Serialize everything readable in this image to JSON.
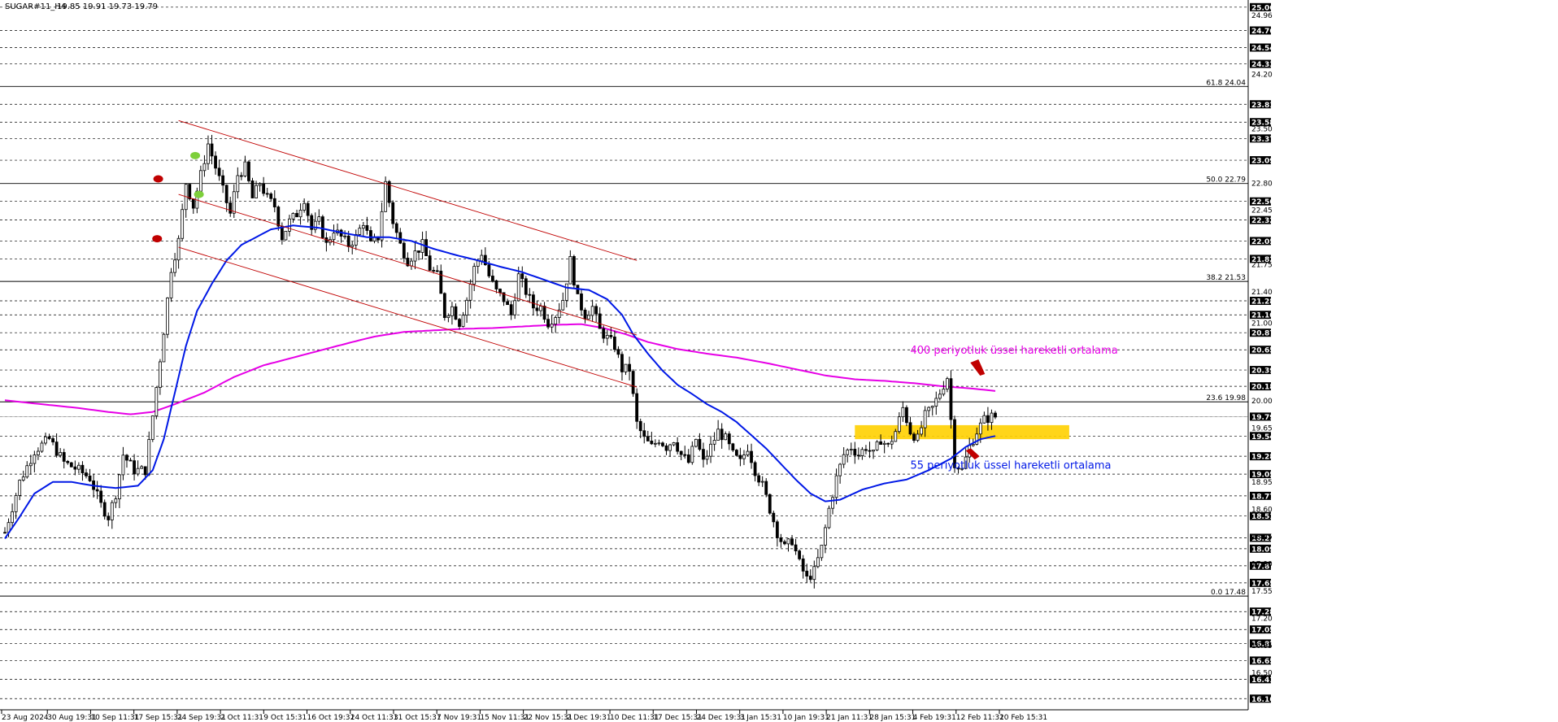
{
  "header": {
    "symbol": "SUGAR#11_H4",
    "ohlc": "19.85 19.91 19.73 19.79"
  },
  "colors": {
    "background": "#ffffff",
    "candle": "#000000",
    "ema55": "#0018e6",
    "ema400": "#e600e6",
    "channel": "#c00000",
    "zone": "#ffd000",
    "price_tag": "#000000",
    "marker_red": "#c00000",
    "marker_green": "#7dcf3a"
  },
  "chart_data": {
    "type": "line",
    "title": "",
    "ylim": [
      16.1,
      25.1
    ],
    "y_ticks_highlighted": [
      "25.06",
      "24.76",
      "24.54",
      "24.33",
      "23.81",
      "23.58",
      "23.37",
      "23.09",
      "22.56",
      "22.32",
      "22.05",
      "21.82",
      "21.28",
      "21.10",
      "20.87",
      "20.65",
      "20.39",
      "20.18",
      "19.79",
      "19.54",
      "19.28",
      "19.05",
      "18.77",
      "18.51",
      "18.23",
      "18.09",
      "17.87",
      "17.65",
      "17.28",
      "17.05",
      "16.87",
      "16.65",
      "16.41",
      "16.16"
    ],
    "y_ticks_plain": [
      "24.96",
      "24.20",
      "23.50",
      "22.80",
      "22.45",
      "21.75",
      "21.40",
      "21.00",
      "20.00",
      "19.65",
      "18.95",
      "18.60",
      "18.25",
      "17.90",
      "17.55",
      "17.20",
      "16.85",
      "16.50"
    ],
    "x_ticks": [
      "23 Aug 2024",
      "30 Aug 19:31",
      "10 Sep 11:31",
      "17 Sep 15:31",
      "24 Sep 19:31",
      "2 Oct 11:31",
      "9 Oct 15:31",
      "16 Oct 19:31",
      "24 Oct 11:31",
      "31 Oct 15:31",
      "7 Nov 19:31",
      "15 Nov 11:31",
      "22 Nov 15:31",
      "2 Dec 19:31",
      "10 Dec 11:31",
      "17 Dec 15:31",
      "24 Dec 19:31",
      "3 Jan 15:31",
      "10 Jan 19:31",
      "21 Jan 11:31",
      "28 Jan 15:31",
      "4 Feb 19:31",
      "12 Feb 11:31",
      "20 Feb 15:31"
    ],
    "fib_levels": [
      {
        "label": "61.8 24.04",
        "value": 24.04
      },
      {
        "label": "50.0 22.79",
        "value": 22.79
      },
      {
        "label": "38.2 21.53",
        "value": 21.53
      },
      {
        "label": "23.6 19.98",
        "value": 19.98
      },
      {
        "label": "0.0 17.48",
        "value": 17.48
      }
    ],
    "current_price_line": 19.79,
    "close_anchors": [
      [
        0,
        18.3
      ],
      [
        4,
        18.95
      ],
      [
        8,
        19.35
      ],
      [
        12,
        19.5
      ],
      [
        16,
        19.2
      ],
      [
        20,
        19.1
      ],
      [
        23,
        19.0
      ],
      [
        26,
        18.65
      ],
      [
        28,
        18.5
      ],
      [
        30,
        18.8
      ],
      [
        32,
        19.3
      ],
      [
        35,
        19.1
      ],
      [
        38,
        19.1
      ],
      [
        40,
        19.8
      ],
      [
        43,
        20.9
      ],
      [
        45,
        21.7
      ],
      [
        47,
        22.05
      ],
      [
        49,
        22.8
      ],
      [
        51,
        22.5
      ],
      [
        53,
        22.9
      ],
      [
        55,
        23.3
      ],
      [
        57,
        23.0
      ],
      [
        59,
        22.7
      ],
      [
        61,
        22.4
      ],
      [
        63,
        22.9
      ],
      [
        65,
        23.0
      ],
      [
        67,
        22.6
      ],
      [
        69,
        22.8
      ],
      [
        71,
        22.6
      ],
      [
        73,
        22.5
      ],
      [
        75,
        22.1
      ],
      [
        77,
        22.3
      ],
      [
        79,
        22.4
      ],
      [
        81,
        22.6
      ],
      [
        83,
        22.2
      ],
      [
        85,
        22.3
      ],
      [
        87,
        22.0
      ],
      [
        89,
        22.2
      ],
      [
        91,
        22.1
      ],
      [
        93,
        22.0
      ],
      [
        95,
        22.1
      ],
      [
        97,
        22.3
      ],
      [
        99,
        22.0
      ],
      [
        101,
        22.1
      ],
      [
        103,
        22.8
      ],
      [
        105,
        22.3
      ],
      [
        107,
        22.0
      ],
      [
        109,
        21.8
      ],
      [
        111,
        21.9
      ],
      [
        113,
        22.0
      ],
      [
        115,
        21.7
      ],
      [
        117,
        21.6
      ],
      [
        119,
        21.1
      ],
      [
        121,
        21.2
      ],
      [
        123,
        21.0
      ],
      [
        125,
        21.3
      ],
      [
        127,
        21.7
      ],
      [
        129,
        21.9
      ],
      [
        131,
        21.6
      ],
      [
        133,
        21.4
      ],
      [
        135,
        21.3
      ],
      [
        137,
        21.1
      ],
      [
        139,
        21.6
      ],
      [
        141,
        21.4
      ],
      [
        143,
        21.2
      ],
      [
        145,
        21.2
      ],
      [
        147,
        21.0
      ],
      [
        149,
        21.1
      ],
      [
        151,
        21.3
      ],
      [
        153,
        21.8
      ],
      [
        155,
        21.3
      ],
      [
        157,
        21.1
      ],
      [
        159,
        21.2
      ],
      [
        161,
        20.9
      ],
      [
        163,
        20.8
      ],
      [
        165,
        20.7
      ],
      [
        167,
        20.4
      ],
      [
        169,
        20.4
      ],
      [
        171,
        19.7
      ],
      [
        173,
        19.5
      ],
      [
        175,
        19.4
      ],
      [
        177,
        19.5
      ],
      [
        179,
        19.4
      ],
      [
        181,
        19.5
      ],
      [
        183,
        19.3
      ],
      [
        185,
        19.2
      ],
      [
        187,
        19.5
      ],
      [
        189,
        19.2
      ],
      [
        191,
        19.4
      ],
      [
        193,
        19.6
      ],
      [
        195,
        19.5
      ],
      [
        197,
        19.3
      ],
      [
        199,
        19.2
      ],
      [
        201,
        19.4
      ],
      [
        203,
        19.1
      ],
      [
        205,
        18.9
      ],
      [
        207,
        18.6
      ],
      [
        209,
        18.3
      ],
      [
        211,
        18.1
      ],
      [
        213,
        18.2
      ],
      [
        215,
        17.9
      ],
      [
        217,
        17.7
      ],
      [
        219,
        17.8
      ],
      [
        221,
        18.1
      ],
      [
        223,
        18.6
      ],
      [
        225,
        19.0
      ],
      [
        227,
        19.3
      ],
      [
        229,
        19.4
      ],
      [
        231,
        19.3
      ],
      [
        233,
        19.4
      ],
      [
        235,
        19.3
      ],
      [
        237,
        19.5
      ],
      [
        239,
        19.4
      ],
      [
        241,
        19.6
      ],
      [
        243,
        19.9
      ],
      [
        245,
        19.6
      ],
      [
        247,
        19.5
      ],
      [
        249,
        19.8
      ],
      [
        251,
        19.9
      ],
      [
        253,
        20.1
      ],
      [
        255,
        20.3
      ],
      [
        257,
        19.2
      ],
      [
        259,
        19.1
      ],
      [
        261,
        19.4
      ],
      [
        263,
        19.6
      ],
      [
        265,
        19.75
      ],
      [
        267,
        19.79
      ]
    ],
    "ema55_anchors": [
      [
        0,
        18.22
      ],
      [
        4,
        18.5
      ],
      [
        8,
        18.8
      ],
      [
        13,
        18.95
      ],
      [
        18,
        18.95
      ],
      [
        24,
        18.9
      ],
      [
        30,
        18.87
      ],
      [
        36,
        18.9
      ],
      [
        40,
        19.1
      ],
      [
        43,
        19.5
      ],
      [
        46,
        20.1
      ],
      [
        49,
        20.7
      ],
      [
        52,
        21.15
      ],
      [
        56,
        21.5
      ],
      [
        60,
        21.8
      ],
      [
        64,
        22.0
      ],
      [
        68,
        22.1
      ],
      [
        72,
        22.2
      ],
      [
        78,
        22.25
      ],
      [
        85,
        22.22
      ],
      [
        92,
        22.15
      ],
      [
        98,
        22.1
      ],
      [
        104,
        22.1
      ],
      [
        110,
        22.05
      ],
      [
        116,
        21.95
      ],
      [
        122,
        21.87
      ],
      [
        128,
        21.8
      ],
      [
        134,
        21.72
      ],
      [
        140,
        21.65
      ],
      [
        146,
        21.55
      ],
      [
        152,
        21.45
      ],
      [
        158,
        21.42
      ],
      [
        163,
        21.3
      ],
      [
        167,
        21.1
      ],
      [
        170,
        20.85
      ],
      [
        174,
        20.6
      ],
      [
        178,
        20.38
      ],
      [
        182,
        20.2
      ],
      [
        186,
        20.08
      ],
      [
        190,
        19.95
      ],
      [
        194,
        19.85
      ],
      [
        198,
        19.72
      ],
      [
        202,
        19.55
      ],
      [
        206,
        19.38
      ],
      [
        210,
        19.18
      ],
      [
        214,
        18.98
      ],
      [
        218,
        18.8
      ],
      [
        222,
        18.7
      ],
      [
        226,
        18.72
      ],
      [
        232,
        18.85
      ],
      [
        238,
        18.93
      ],
      [
        244,
        18.98
      ],
      [
        250,
        19.1
      ],
      [
        256,
        19.25
      ],
      [
        260,
        19.4
      ],
      [
        264,
        19.5
      ],
      [
        268,
        19.54
      ]
    ],
    "ema400_anchors": [
      [
        0,
        20.0
      ],
      [
        10,
        19.95
      ],
      [
        20,
        19.9
      ],
      [
        28,
        19.85
      ],
      [
        34,
        19.82
      ],
      [
        40,
        19.85
      ],
      [
        46,
        19.95
      ],
      [
        54,
        20.1
      ],
      [
        62,
        20.3
      ],
      [
        70,
        20.45
      ],
      [
        78,
        20.55
      ],
      [
        86,
        20.65
      ],
      [
        94,
        20.75
      ],
      [
        100,
        20.82
      ],
      [
        108,
        20.88
      ],
      [
        116,
        20.9
      ],
      [
        124,
        20.92
      ],
      [
        132,
        20.93
      ],
      [
        140,
        20.95
      ],
      [
        148,
        20.97
      ],
      [
        156,
        20.98
      ],
      [
        162,
        20.93
      ],
      [
        168,
        20.85
      ],
      [
        174,
        20.75
      ],
      [
        182,
        20.66
      ],
      [
        190,
        20.6
      ],
      [
        198,
        20.55
      ],
      [
        206,
        20.48
      ],
      [
        214,
        20.4
      ],
      [
        222,
        20.32
      ],
      [
        230,
        20.27
      ],
      [
        238,
        20.25
      ],
      [
        246,
        20.22
      ],
      [
        254,
        20.18
      ],
      [
        262,
        20.15
      ],
      [
        268,
        20.12
      ]
    ],
    "channel_lines": [
      {
        "x1": 47,
        "y1": 23.6,
        "x2": 171,
        "y2": 21.8
      },
      {
        "x1": 47,
        "y1": 22.65,
        "x2": 171,
        "y2": 20.84
      },
      {
        "x1": 47,
        "y1": 21.97,
        "x2": 171,
        "y2": 20.17
      }
    ],
    "zone": {
      "x1": 230,
      "x2": 288,
      "y1": 19.5,
      "y2": 19.68
    },
    "annotations": [
      {
        "text": "400 periyotluk üssel hareketli ortalama",
        "x": 245,
        "y": 20.6,
        "color": "ema400"
      },
      {
        "text": "55 periyotluk üssel hareketli ortalama",
        "x": 245,
        "y": 19.12,
        "color": "ema55"
      }
    ],
    "markers": [
      {
        "x": 41.5,
        "y": 22.85,
        "color": "marker_red",
        "shape": "dot"
      },
      {
        "x": 41.2,
        "y": 22.08,
        "color": "marker_red",
        "shape": "dot"
      },
      {
        "x": 51.5,
        "y": 23.15,
        "color": "marker_green",
        "shape": "dot"
      },
      {
        "x": 52.5,
        "y": 22.65,
        "color": "marker_green",
        "shape": "dot"
      },
      {
        "x": 263,
        "y": 20.38,
        "color": "marker_red",
        "shape": "arrow-down"
      },
      {
        "x": 262,
        "y": 19.3,
        "color": "marker_red",
        "shape": "arrow-up"
      }
    ]
  }
}
